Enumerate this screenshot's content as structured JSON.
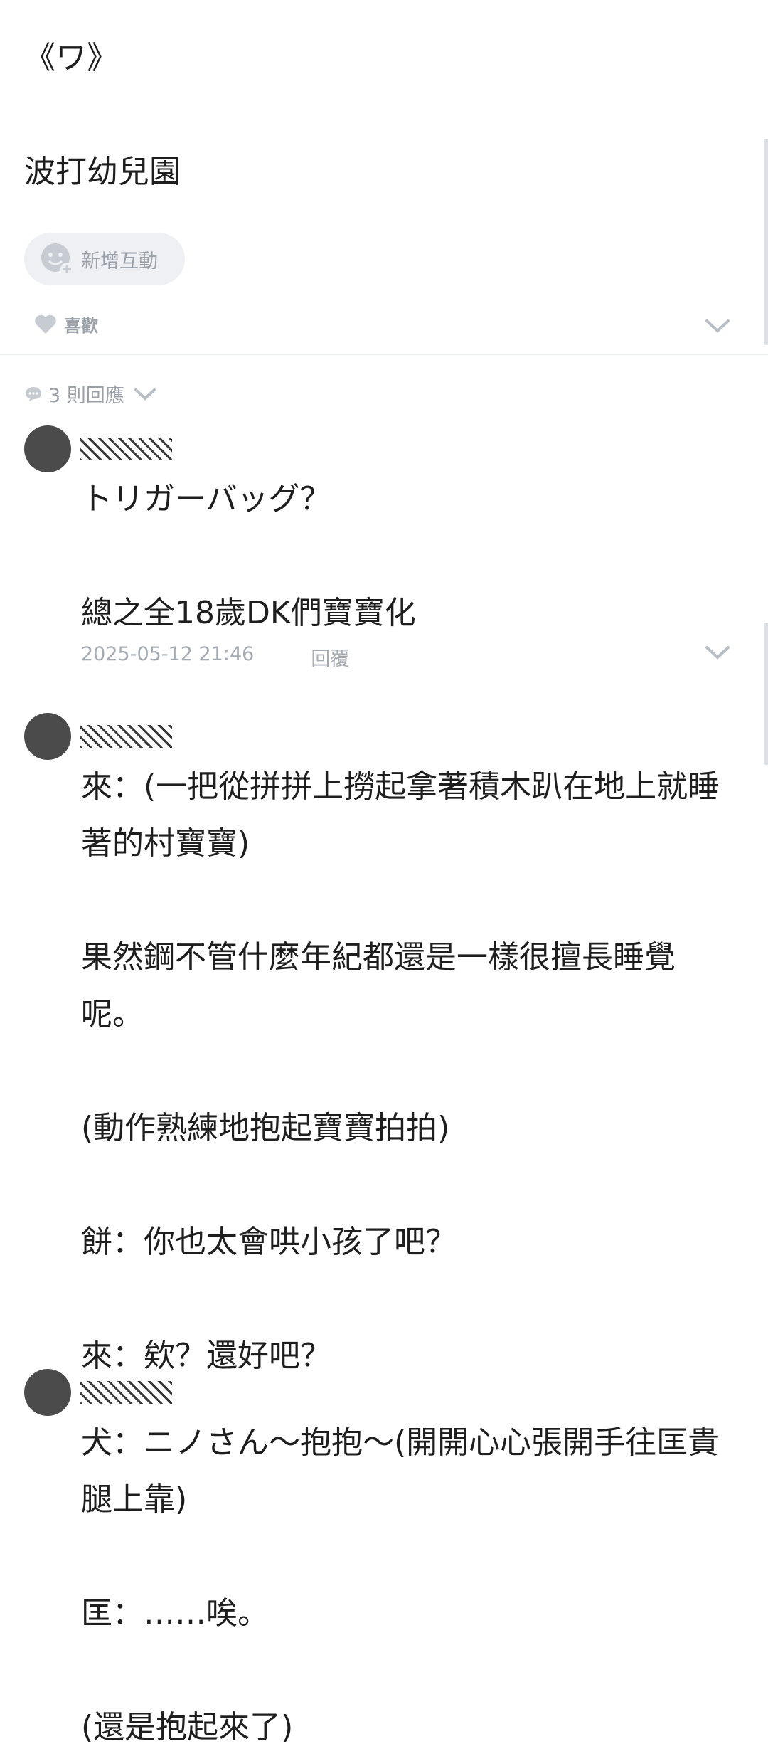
{
  "post": {
    "title": "《ワ》",
    "subtitle": "波打幼兒園",
    "add_reaction_label": "新增互動",
    "like_label": "喜歡"
  },
  "comments_header": {
    "count_label": "3 則回應"
  },
  "comments": [
    {
      "body": "トリガーバッグ？\n\n總之全18歲DK們寶寶化",
      "timestamp": "2025-05-12 21:46",
      "reply_label": "回覆"
    },
    {
      "body": "來：(一把從拼拼上撈起拿著積木趴在地上就睡著的村寶寶)\n\n果然鋼不管什麼年紀都還是一樣很擅長睡覺呢。\n\n(動作熟練地抱起寶寶拍拍)\n\n餅：你也太會哄小孩了吧？\n\n來：欸？還好吧？"
    },
    {
      "body": "犬：ニノさん～抱抱～(開開心心張開手往匡貴腿上靠)\n\n匡：……唉。\n\n(還是抱起來了)"
    }
  ],
  "colors": {
    "muted": "#9aa0a8",
    "avatar": "#4b4b4b",
    "divider": "#eceef1"
  },
  "icons": [
    "smiley-add-icon",
    "heart-icon",
    "chevron-down-icon",
    "comment-bubble-icon"
  ]
}
